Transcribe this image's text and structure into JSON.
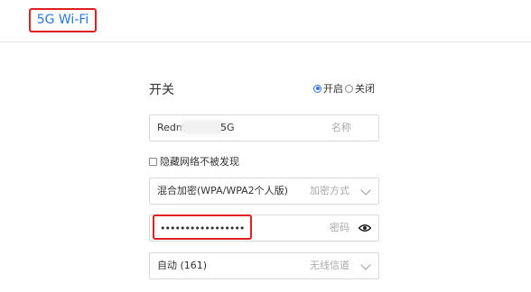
{
  "page": {
    "title": "5G Wi-Fi"
  },
  "switch": {
    "label": "开关",
    "options": [
      {
        "label": "开启",
        "selected": true
      },
      {
        "label": "关闭",
        "selected": false
      }
    ]
  },
  "ssid": {
    "value_prefix": "Redm",
    "value_suffix": "5G",
    "hint": "名称"
  },
  "hide_network": {
    "label": "隐藏网络不被发现",
    "checked": false
  },
  "encryption": {
    "value": "混合加密(WPA/WPA2个人版)",
    "hint": "加密方式"
  },
  "password": {
    "value": "•••••••••••••••••",
    "hint": "密码"
  },
  "channel": {
    "value": "自动 (161)",
    "hint": "无线信道"
  },
  "colors": {
    "accent": "#2a78d8",
    "highlight": "#e02020",
    "border": "#d9d9d9"
  }
}
